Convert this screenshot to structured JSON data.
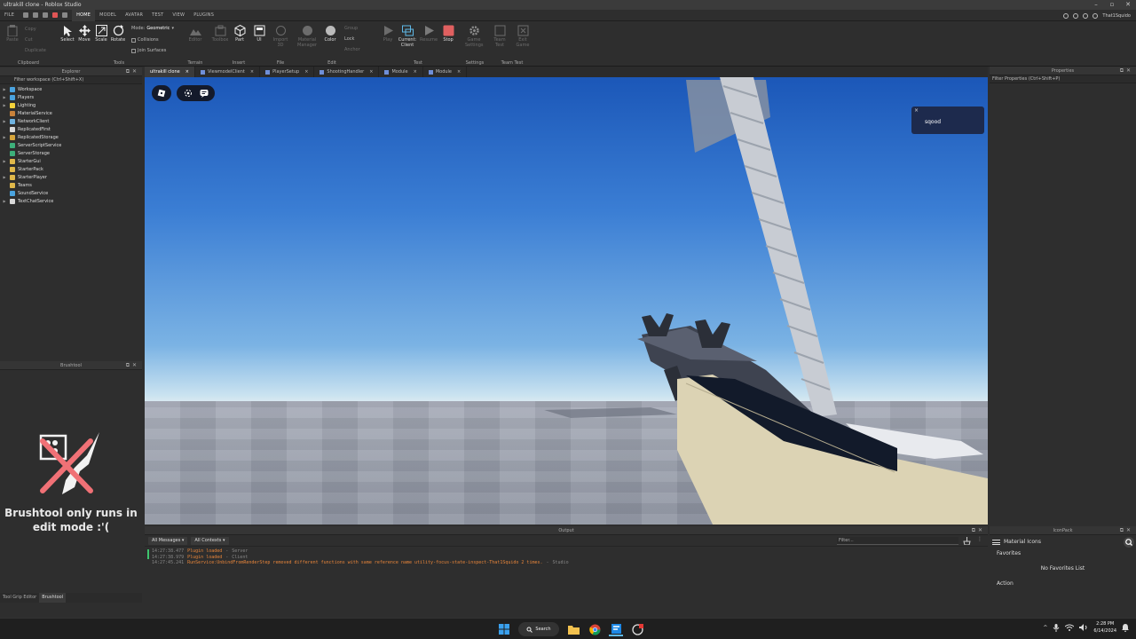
{
  "window": {
    "title": "ultrakill clone - Roblox Studio"
  },
  "menubar": {
    "file": "FILE",
    "tabs": [
      "HOME",
      "MODEL",
      "AVATAR",
      "TEST",
      "VIEW",
      "PLUGINS"
    ],
    "active_tab": "HOME",
    "username": "That1Squido"
  },
  "ribbon": {
    "clipboard": {
      "paste": "Paste",
      "copy": "Copy",
      "cut": "Cut",
      "duplicate": "Duplicate",
      "label": "Clipboard"
    },
    "tools": {
      "select": "Select",
      "move": "Move",
      "scale": "Scale",
      "rotate": "Rotate",
      "mode_label": "Mode:",
      "mode_value": "Geometric",
      "collisions": "Collisions",
      "join_surfaces": "Join Surfaces",
      "label": "Tools"
    },
    "terrain": {
      "editor": "Editor",
      "label": "Terrain"
    },
    "insert": {
      "toolbox": "Toolbox",
      "part": "Part",
      "ui": "UI",
      "label": "Insert"
    },
    "file": {
      "import3d": "Import 3D",
      "label": "File"
    },
    "edit": {
      "material_manager": "Material Manager",
      "color": "Color",
      "group": "Group",
      "lock": "Lock",
      "anchor": "Anchor",
      "label": "Edit"
    },
    "test": {
      "play": "Play",
      "current_client": "Current: Client",
      "resume": "Resume",
      "stop": "Stop",
      "label": "Test"
    },
    "settings": {
      "game_settings": "Game Settings",
      "label": "Settings"
    },
    "team_test": {
      "team_test": "Team Test",
      "exit_game": "Exit Game",
      "label": "Team Test"
    }
  },
  "explorer": {
    "title": "Explorer",
    "filter": "Filter workspace (Ctrl+Shift+X)",
    "items": [
      {
        "label": "Workspace",
        "color": "#4aa3df",
        "arrow": true
      },
      {
        "label": "Players",
        "color": "#4aa3df",
        "arrow": true
      },
      {
        "label": "Lighting",
        "color": "#f2d13a",
        "arrow": true
      },
      {
        "label": "MaterialService",
        "color": "#c9823a",
        "arrow": false
      },
      {
        "label": "NetworkClient",
        "color": "#6fb3e0",
        "arrow": true
      },
      {
        "label": "ReplicatedFirst",
        "color": "#d9d9d9",
        "arrow": false
      },
      {
        "label": "ReplicatedStorage",
        "color": "#d6a53c",
        "arrow": true
      },
      {
        "label": "ServerScriptService",
        "color": "#3db07a",
        "arrow": false
      },
      {
        "label": "ServerStorage",
        "color": "#3db07a",
        "arrow": false
      },
      {
        "label": "StarterGui",
        "color": "#e0b84a",
        "arrow": true
      },
      {
        "label": "StarterPack",
        "color": "#e0b84a",
        "arrow": false
      },
      {
        "label": "StarterPlayer",
        "color": "#e0b84a",
        "arrow": true
      },
      {
        "label": "Teams",
        "color": "#e0b84a",
        "arrow": false
      },
      {
        "label": "SoundService",
        "color": "#4aa3df",
        "arrow": false
      },
      {
        "label": "TextChatService",
        "color": "#d9d9d9",
        "arrow": true
      }
    ]
  },
  "brushtool": {
    "title": "Brushtool",
    "message_line1": "Brushtool only runs in",
    "message_line2": "edit mode :'("
  },
  "left_tabs": [
    "Tool Grip Editor",
    "Brushtool"
  ],
  "doc_tabs": [
    {
      "label": "ultrakill clone",
      "active": true
    },
    {
      "label": "ViewmodelClient",
      "active": false
    },
    {
      "label": "PlayerSetup",
      "active": false
    },
    {
      "label": "ShootingHandler",
      "active": false
    },
    {
      "label": "Module",
      "active": false
    },
    {
      "label": "Module",
      "active": false
    }
  ],
  "viewport": {
    "chat_popup_text": "sqood",
    "chat_close": "×",
    "sky_color": "#3b7ed4"
  },
  "output": {
    "title": "Output",
    "messages_dropdown": "All Messages",
    "contexts_dropdown": "All Contexts",
    "filter_placeholder": "Filter...",
    "logs": [
      {
        "time": "14:27:38.477",
        "msg": "Plugin loaded",
        "sep": "-",
        "ctx": "Server"
      },
      {
        "time": "14:27:38.979",
        "msg": "Plugin loaded",
        "sep": "-",
        "ctx": "Client"
      },
      {
        "time": "14:27:45.241",
        "msg": "RunService:UnbindFromRenderStep removed different functions with same reference name utility-focus-state-inspect-That1Squido 2 times.",
        "sep": "-",
        "ctx": "Studio"
      }
    ]
  },
  "properties": {
    "title": "Properties",
    "filter": "Filter Properties (Ctrl+Shift+P)"
  },
  "iconpack": {
    "title": "IconPack",
    "search_label": "Material Icons",
    "favorites": "Favorites",
    "no_favorites": "No Favorites List",
    "action": "Action"
  },
  "taskbar": {
    "search": "Search",
    "time": "2:28 PM",
    "date": "6/14/2024"
  }
}
